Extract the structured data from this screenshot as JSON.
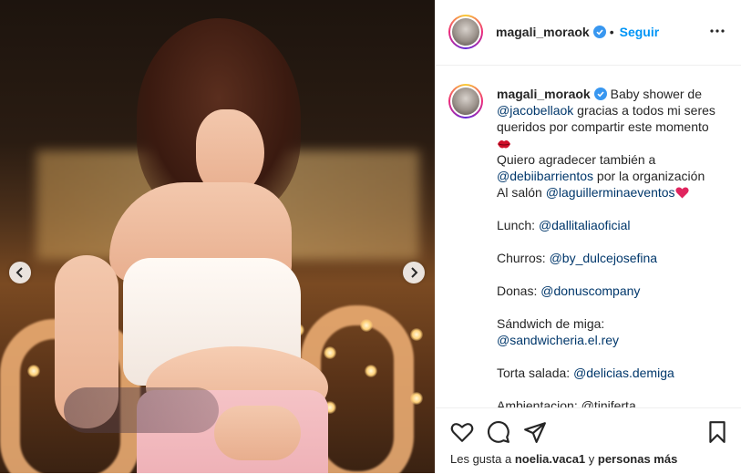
{
  "post": {
    "author": "magali_moraok",
    "follow_label": "Seguir",
    "separator": "•",
    "caption": {
      "intro": "Baby shower de",
      "m1": "@jacobellaok",
      "line1_rest": " gracias a todos mi seres queridos por compartir este momento ",
      "line2": "Quiero agradecer también a ",
      "m2": "@debiibarrientos",
      "line2_rest": " por la organización",
      "line3": "Al salón ",
      "m3": "@laguillerminaeventos",
      "lunch_label": "Lunch: ",
      "m4": "@dallitaliaoficial",
      "churros_label": "Churros: ",
      "m5": "@by_dulcejosefina",
      "donas_label": "Donas: ",
      "m6": "@donuscompany",
      "sandwich_label": "Sándwich de miga: ",
      "m7": "@sandwicheria.el.rey",
      "torta_label": "Torta salada: ",
      "m8": "@delicias.demiga",
      "cut_line": "Ambientacion: @tiniferta"
    },
    "likes": {
      "prefix": "Les gusta a ",
      "user": "noelia.vaca1",
      "middle": " y ",
      "others": "personas más"
    }
  },
  "icons": {
    "verified": "verified-badge-icon",
    "more": "more-options-icon",
    "like": "heart-icon",
    "comment": "comment-icon",
    "share": "share-icon",
    "save": "bookmark-icon",
    "prev": "chevron-left-icon",
    "next": "chevron-right-icon"
  },
  "colors": {
    "accent": "#0095f6",
    "mention": "#00376b",
    "verified": "#3897f0"
  }
}
